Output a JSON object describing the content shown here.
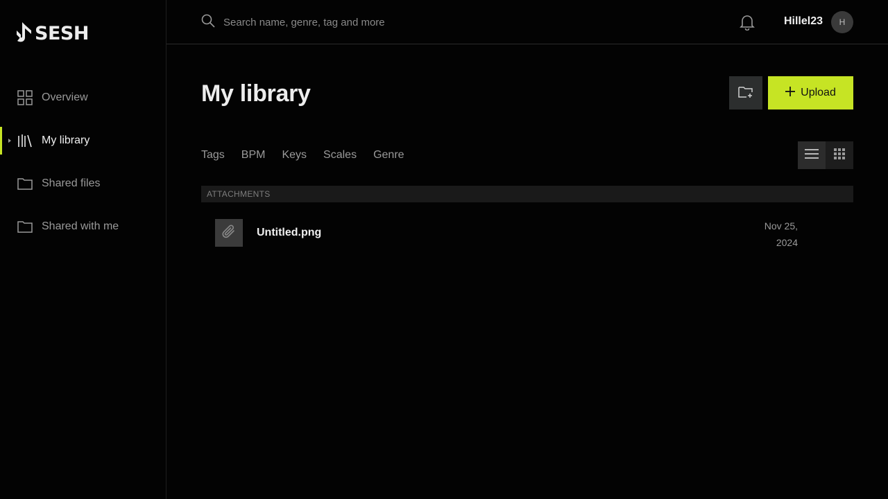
{
  "app": {
    "logo_text": "SESH"
  },
  "colors": {
    "accent": "#c6e424",
    "background": "#030303"
  },
  "sidebar": {
    "items": [
      {
        "label": "Overview",
        "icon": "grid-icon",
        "active": false
      },
      {
        "label": "My library",
        "icon": "library-icon",
        "active": true
      },
      {
        "label": "Shared files",
        "icon": "folder-icon",
        "active": false
      },
      {
        "label": "Shared with me",
        "icon": "folder-icon",
        "active": false
      }
    ]
  },
  "topbar": {
    "search_placeholder": "Search name, genre, tag and more",
    "username": "Hillel23",
    "avatar_initial": "H"
  },
  "main": {
    "title": "My library",
    "upload_label": "Upload",
    "filters": [
      "Tags",
      "BPM",
      "Keys",
      "Scales",
      "Genre"
    ],
    "sections": [
      {
        "header": "ATTACHMENTS",
        "files": [
          {
            "name": "Untitled.png",
            "date_line1": "Nov 25,",
            "date_line2": "2024",
            "icon": "paperclip-icon"
          }
        ]
      }
    ]
  }
}
